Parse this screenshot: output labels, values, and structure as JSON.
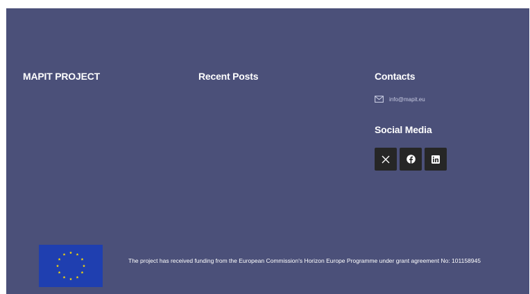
{
  "footer": {
    "project_title": "MAPIT PROJECT",
    "recent_posts_title": "Recent Posts",
    "contacts_title": "Contacts",
    "contact_icon": "mail-icon",
    "contact_email": "info@mapit.eu",
    "social_title": "Social Media",
    "social_links": [
      {
        "icon": "x-twitter-icon"
      },
      {
        "icon": "facebook-icon"
      },
      {
        "icon": "linkedin-icon"
      }
    ],
    "funding_text": "The project has received funding from the European Commission's Horizon Europe Programme under grant agreement No: 101158945",
    "flag_icon": "eu-flag-icon"
  },
  "colors": {
    "footer_background": "#4b5079",
    "social_button": "#262626",
    "eu_blue": "#1f3fb0",
    "eu_star": "#ffdd00"
  }
}
